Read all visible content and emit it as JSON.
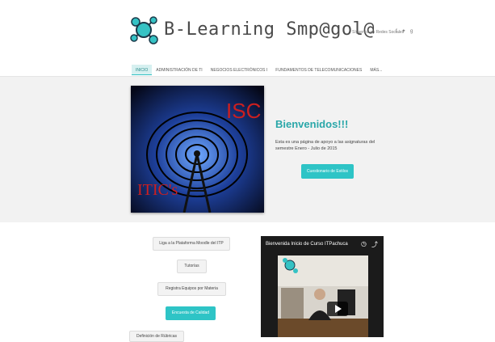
{
  "header": {
    "logo_text": "B-Learning Smp@gol@",
    "social_label": "Síguenos en Redes Sociales",
    "social_icons": [
      "facebook-icon",
      "twitter-icon",
      "googleplus-icon"
    ]
  },
  "nav": {
    "items": [
      "INICIO",
      "ADMINISTRACIÓN DE TI",
      "NEGOCIOS ELECTRÓNICOS I",
      "FUNDAMENTOS DE TELECOMUNICACIONES",
      "MÁS..."
    ]
  },
  "hero": {
    "image_labels": [
      "ISC",
      "ITIC's"
    ],
    "title": "Bienvenidos!!!",
    "text": "Esta es una página de apoyo a las asignaturas del semestre Enero - Julio de 2015",
    "button": "Cuestionario de Estilos"
  },
  "links": {
    "moodle": "Liga a la Plataforma Moodle del ITP",
    "tutorias": "Tutorías",
    "registro": "Registra Equipos por Materia",
    "encuesta": "Encuesta de Calidad",
    "partial": "Definición de Rúbricas"
  },
  "video": {
    "title": "Bienvenida Inicio de Curso ITPachuca"
  },
  "colors": {
    "accent": "#2ec4c6",
    "hero_bg": "#f2f2f2"
  }
}
